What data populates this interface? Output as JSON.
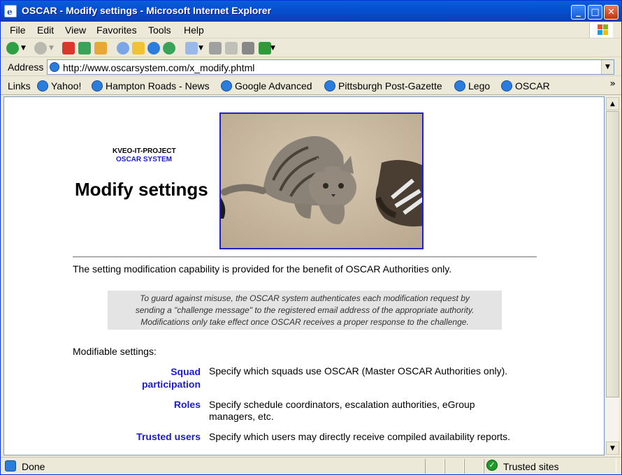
{
  "window": {
    "title": "OSCAR - Modify settings - Microsoft Internet Explorer",
    "app_icon": "ie-page-icon",
    "controls": [
      "minimize",
      "maximize",
      "close"
    ]
  },
  "menu": {
    "items": [
      {
        "label": "File"
      },
      {
        "label": "Edit"
      },
      {
        "label": "View"
      },
      {
        "label": "Favorites"
      },
      {
        "label": "Tools"
      },
      {
        "label": "Help"
      }
    ]
  },
  "toolbar": {
    "buttons": [
      "back-icon",
      "back-dropdown-icon",
      "forward-icon",
      "forward-dropdown-icon",
      "stop-icon",
      "refresh-icon",
      "home-icon",
      "search-icon",
      "favorites-icon",
      "media-icon",
      "history-icon",
      "mail-icon",
      "mail-dropdown-icon",
      "print-icon",
      "edit-icon",
      "discuss-icon",
      "messenger-icon",
      "messenger-dropdown-icon"
    ]
  },
  "address": {
    "label": "Address",
    "url": "http://www.oscarsystem.com/x_modify.phtml"
  },
  "links": {
    "label": "Links",
    "items": [
      {
        "label": "Yahoo!"
      },
      {
        "label": "Hampton Roads - News"
      },
      {
        "label": "Google Advanced"
      },
      {
        "label": "Pittsburgh Post-Gazette"
      },
      {
        "label": "Lego"
      },
      {
        "label": "OSCAR"
      }
    ],
    "more": "»"
  },
  "page": {
    "project": "KVEO-IT-PROJECT",
    "system": "OSCAR SYSTEM",
    "title": "Modify settings",
    "intro": "The setting modification capability is provided for the benefit of OSCAR Authorities only.",
    "notice_lines": [
      "To guard against misuse, the OSCAR system authenticates each modification request by",
      "sending a \"challenge message\" to the registered email address of the appropriate authority.",
      "Modifications only take effect once OSCAR receives a proper response to the challenge."
    ],
    "modifiable_label": "Modifiable settings:",
    "settings": [
      {
        "name_lines": [
          "Squad",
          "participation"
        ],
        "description_lines": [
          "Specify which squads use OSCAR (Master OSCAR Authorities only)."
        ]
      },
      {
        "name_lines": [
          "Roles"
        ],
        "description_lines": [
          "Specify schedule coordinators, escalation authorities, eGroup",
          "managers, etc."
        ]
      },
      {
        "name_lines": [
          "Trusted users"
        ],
        "description_lines": [
          "Specify which users may directly receive compiled availability reports."
        ]
      }
    ],
    "colors": {
      "link": "#1a1ad6",
      "photo_border": "#2020c8",
      "notice_bg": "#e4e4e4"
    }
  },
  "status": {
    "text": "Done",
    "zone": "Trusted sites",
    "zone_icon": "check-shield-icon"
  }
}
